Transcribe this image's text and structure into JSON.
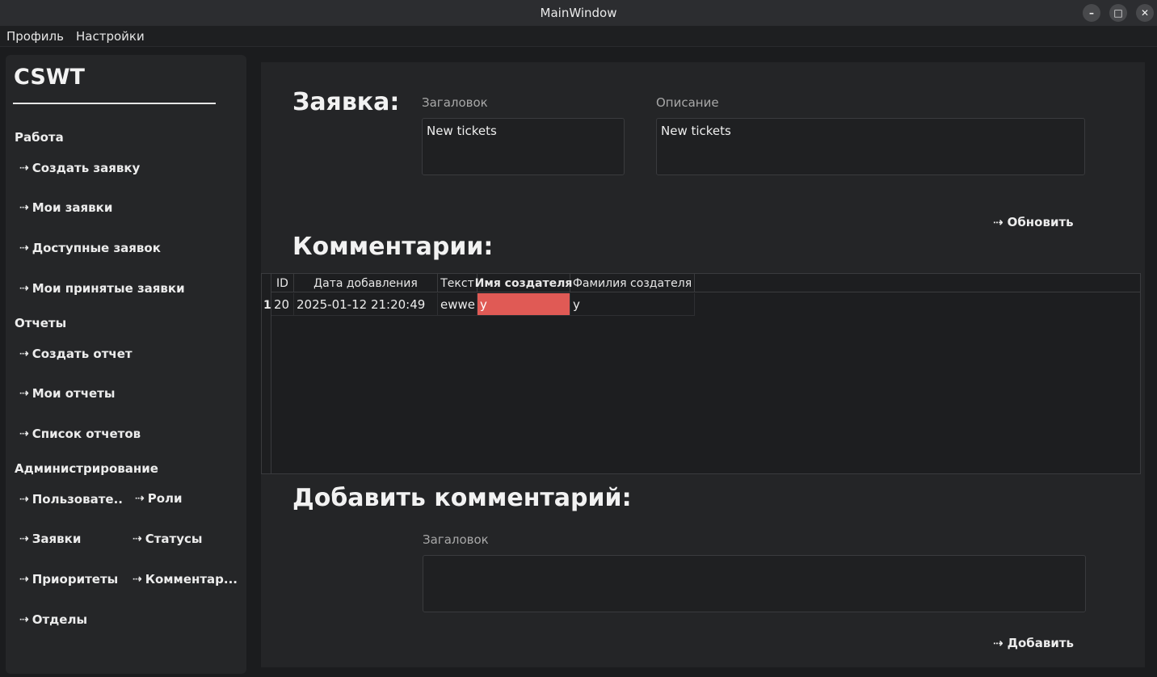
{
  "window": {
    "title": "MainWindow",
    "minimize": "–",
    "maximize": "□",
    "close": "✕"
  },
  "menu": [
    "Профиль",
    "Настройки"
  ],
  "sidebar": {
    "logo": "CSWT",
    "sections": {
      "work": "Работа",
      "reports": "Отчеты",
      "admin": "Администрирование"
    },
    "arrow": "⇢",
    "items": {
      "create_ticket": "Создать заявку",
      "my_tickets": "Мои заявки",
      "available_tickets": "Доступные заявок",
      "accepted_tickets": "Мои принятые заявки",
      "create_report": "Создать отчет",
      "my_reports": "Мои отчеты",
      "report_list": "Список отчетов",
      "users": "Пользовате..",
      "roles": "Роли",
      "tickets": "Заявки",
      "statuses": "Статусы",
      "priorities": "Приоритеты",
      "comments": "Комментар...",
      "departments": "Отделы"
    }
  },
  "ticket": {
    "heading": "Заявка:",
    "title_label": "Загаловок",
    "title_value": "New tickets",
    "desc_label": "Описание",
    "desc_value": "New tickets",
    "refresh": "Обновить"
  },
  "comments": {
    "heading": "Комментарии:",
    "columns": [
      "ID",
      "Дата добавления",
      "Текст",
      "Имя создателя",
      "Фамилия создателя"
    ],
    "rows": [
      {
        "num": "1",
        "cells": [
          "20",
          "2025-01-12 21:20:49",
          "ewwe",
          "y",
          "y"
        ]
      }
    ]
  },
  "add_comment": {
    "heading": "Добавить комментарий:",
    "title_label": "Загаловок",
    "title_value": "",
    "submit": "Добавить"
  }
}
